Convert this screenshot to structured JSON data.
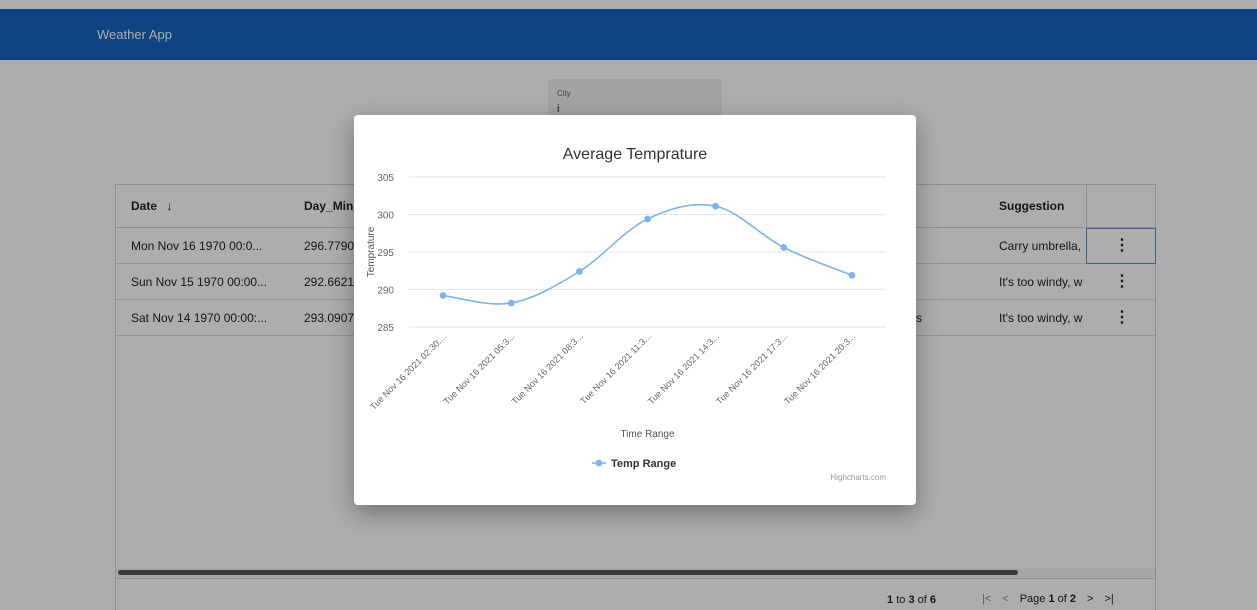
{
  "app": {
    "title": "Weather App"
  },
  "search": {
    "label": "City",
    "value": "i"
  },
  "table": {
    "columns": [
      "Date",
      "Day_Min_",
      "Suggestion"
    ],
    "sort_icon": "arrow-down-icon",
    "rows": [
      {
        "date": "Mon Nov 16 1970 00:0...",
        "day_min": "296.7790",
        "suffix": "",
        "suggestion": "Carry umbrella,"
      },
      {
        "date": "Sun Nov 15 1970 00:00...",
        "day_min": "292.6621",
        "suffix": "",
        "suggestion": "It's too windy, w"
      },
      {
        "date": "Sat Nov 14 1970 00:00:...",
        "day_min": "293.0907",
        "suffix": "s",
        "suggestion": "It's too windy, w"
      }
    ],
    "pagination": {
      "from": "1",
      "to_word": "to",
      "to": "3",
      "of_word": "of",
      "total": "6",
      "page_word": "Page",
      "page": "1",
      "pages": "2",
      "first_icon": "first-page-icon",
      "prev_icon": "prev-page-icon",
      "next_icon": "next-page-icon",
      "last_icon": "last-page-icon"
    }
  },
  "modal": {
    "credit": "Highcharts.com"
  },
  "chart_data": {
    "type": "line",
    "title": "Average Temprature",
    "xlabel": "Time Range",
    "ylabel": "Temprature",
    "ylim": [
      285,
      305
    ],
    "yticks": [
      285,
      290,
      295,
      300,
      305
    ],
    "categories": [
      "Tue Nov 16 2021 02:30:...",
      "Tue Nov 16 2021 05:3...",
      "Tue Nov 16 2021 08:3...",
      "Tue Nov 16 2021 11:3...",
      "Tue Nov 16 2021 14:3...",
      "Tue Nov 16 2021 17:3...",
      "Tue Nov 16 2021 20:3..."
    ],
    "series": [
      {
        "name": "Temp Range",
        "values": [
          289.2,
          288.2,
          292.4,
          299.4,
          301.1,
          295.6,
          291.9
        ],
        "color": "#7cb5ec"
      }
    ],
    "grid": true,
    "legend": "bottom-center"
  }
}
